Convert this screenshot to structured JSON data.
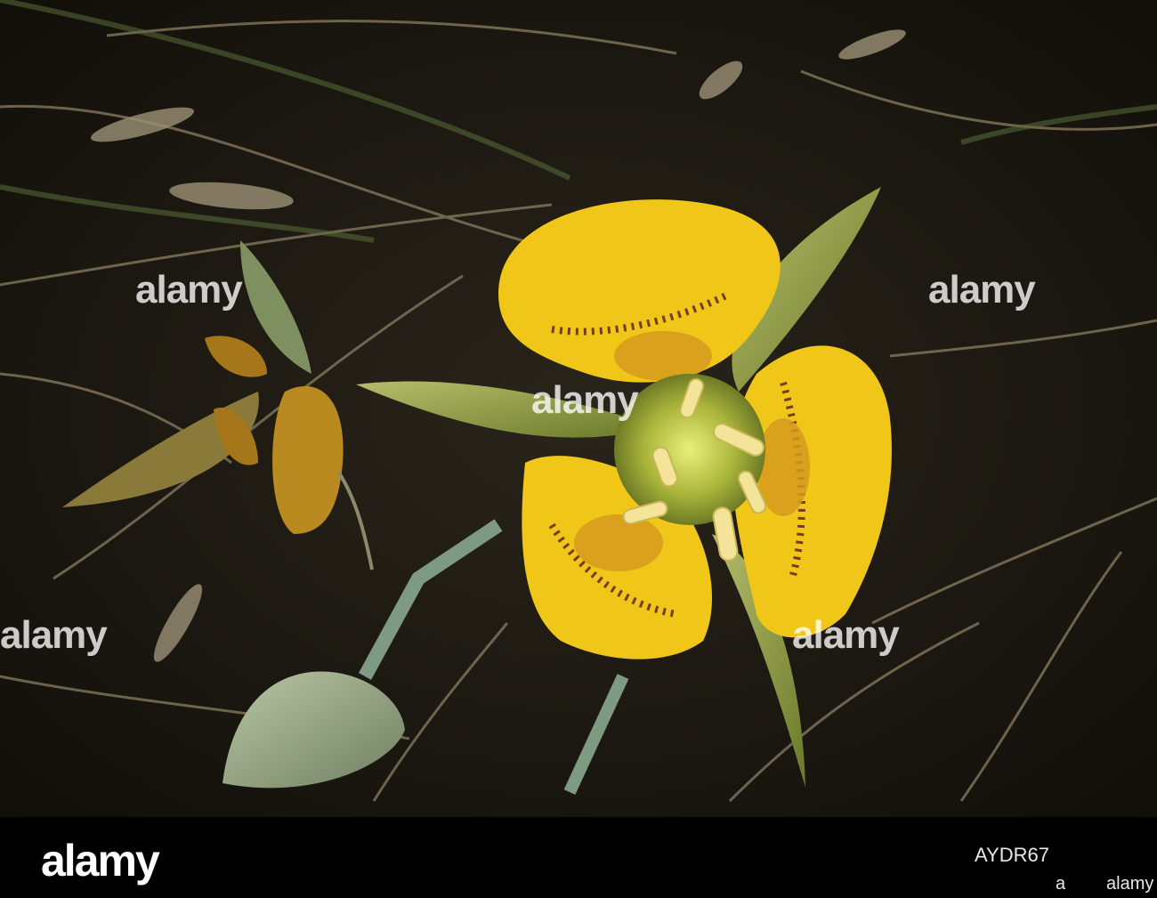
{
  "watermark": {
    "text": "alamy"
  },
  "footer": {
    "logo": "alamy",
    "image_code": "AYDR67",
    "brand_left": "a",
    "brand_right": "alamy"
  }
}
